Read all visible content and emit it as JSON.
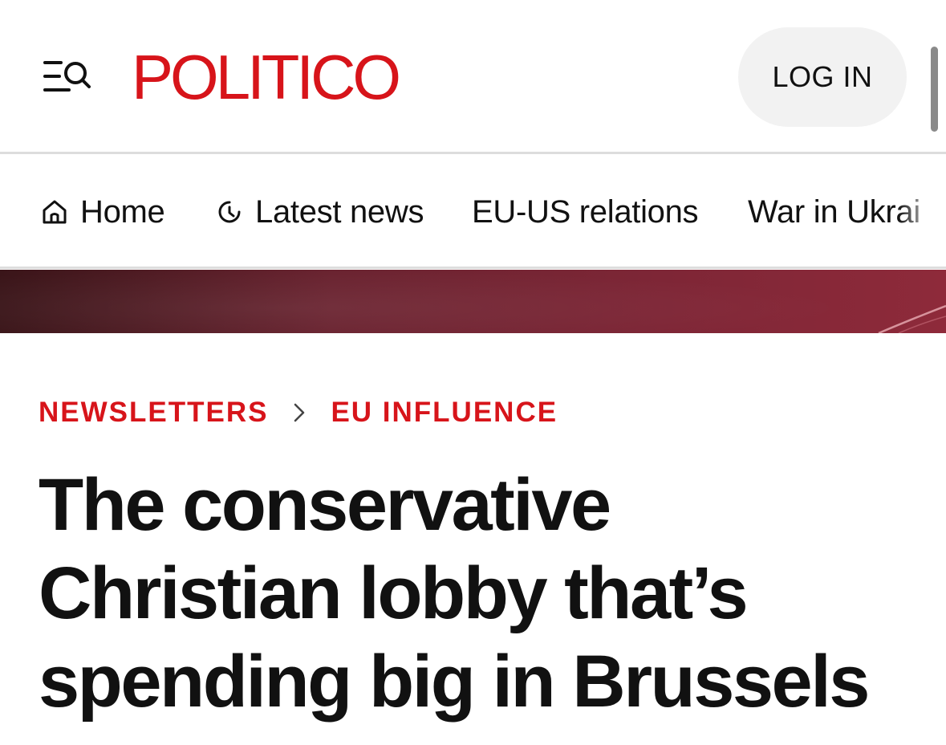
{
  "header": {
    "logo_text": "POLITICO",
    "login_label": "LOG IN",
    "menu_icon": "menu-search-icon",
    "brand_color": "#d7141a"
  },
  "nav": {
    "items": [
      {
        "label": "Home",
        "icon": "home-icon"
      },
      {
        "label": "Latest news",
        "icon": "clock-icon"
      },
      {
        "label": "EU-US relations"
      },
      {
        "label": "War in Ukrai"
      }
    ]
  },
  "breadcrumb": {
    "items": [
      "NEWSLETTERS",
      "EU INFLUENCE"
    ],
    "separator_icon": "chevron-right-icon"
  },
  "article": {
    "headline_lines": [
      "The conservative",
      "Christian lobby that’s",
      "spending big in Brussels"
    ]
  }
}
